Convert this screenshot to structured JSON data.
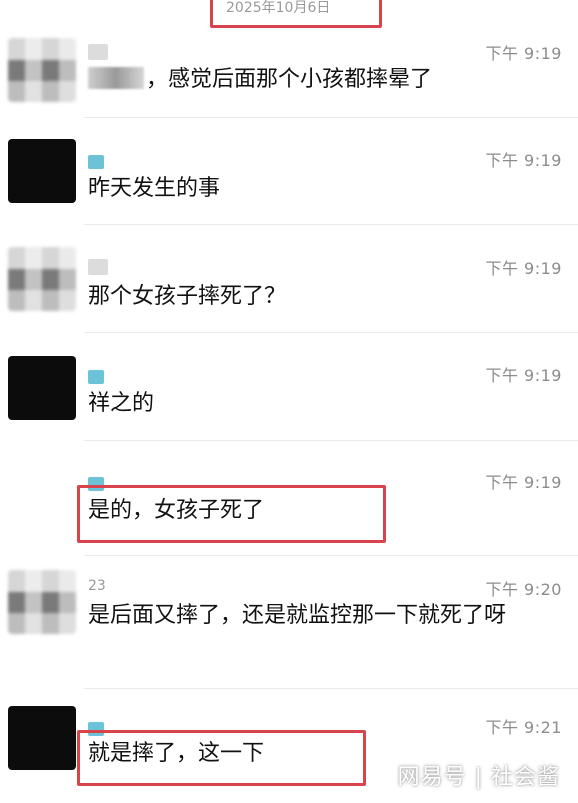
{
  "header": {
    "date": "2025年10月6日"
  },
  "messages": [
    {
      "sender": "",
      "time": "下午 9:19",
      "text": "，感觉后面那个小孩都摔晕了"
    },
    {
      "sender": "",
      "time": "下午 9:19",
      "text": "昨天发生的事"
    },
    {
      "sender": "",
      "time": "下午 9:19",
      "text": "那个女孩子摔死了？"
    },
    {
      "sender": "",
      "time": "下午 9:19",
      "text": "祥之的"
    },
    {
      "sender": "",
      "time": "下午 9:19",
      "text": "是的，女孩子死了"
    },
    {
      "sender": "23",
      "time": "下午 9:20",
      "text": "是后面又摔了，还是就监控那一下就死了呀"
    },
    {
      "sender": "",
      "time": "下午 9:21",
      "text": "就是摔了，这一下"
    }
  ],
  "watermark": "网易号 | 社会酱",
  "colors": {
    "highlight": "#d9434b",
    "time": "#8c8c8c"
  }
}
